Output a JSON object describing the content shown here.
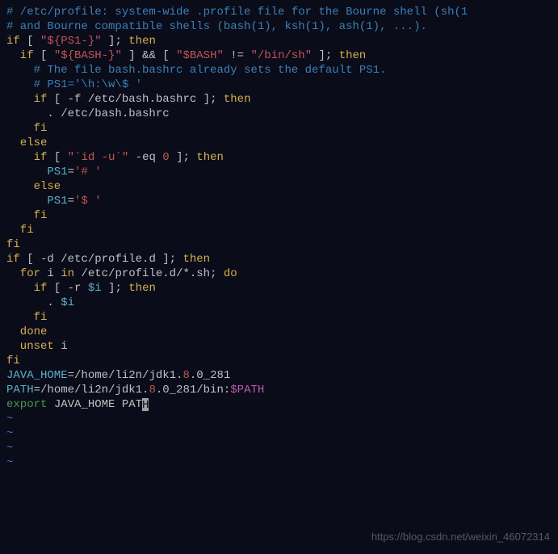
{
  "lines": {
    "l1_comment": "# /etc/profile: system-wide .profile file for the Bourne shell (sh(1",
    "l2_comment": "# and Bourne compatible shells (bash(1), ksh(1), ash(1), ...).",
    "l3": "",
    "l4_if": "if",
    "l4_mid": " [ ",
    "l4_str": "\"${PS1-}\"",
    "l4_end": " ]; ",
    "l4_then": "then",
    "l5_if": "  if",
    "l5_a": " [ ",
    "l5_s1": "\"${BASH-}\"",
    "l5_b": " ] && [ ",
    "l5_s2": "\"$BASH\"",
    "l5_c": " != ",
    "l5_s3": "\"/bin/sh\"",
    "l5_d": " ]; ",
    "l5_then": "then",
    "l6_comment": "    # The file bash.bashrc already sets the default PS1.",
    "l7_comment": "    # PS1='\\h:\\w\\$ '",
    "l8_if": "    if",
    "l8_a": " [ -f ",
    "l8_p": "/etc/bash.bashrc",
    "l8_b": " ]; ",
    "l8_then": "then",
    "l9_a": "      . ",
    "l9_p": "/etc/bash.bashrc",
    "l10_fi": "    fi",
    "l11_else": "  else",
    "l12_if": "    if",
    "l12_a": " [ ",
    "l12_s1": "\"`id -u`\"",
    "l12_b": " -eq ",
    "l12_n": "0",
    "l12_c": " ]; ",
    "l12_then": "then",
    "l13_v": "      PS1",
    "l13_eq": "=",
    "l13_s": "'# '",
    "l14_else": "    else",
    "l15_v": "      PS1",
    "l15_eq": "=",
    "l15_s": "'$ '",
    "l16_fi": "    fi",
    "l17_fi": "  fi",
    "l18_fi": "fi",
    "l19": "",
    "l20_if": "if",
    "l20_a": " [ -d ",
    "l20_p": "/etc/profile.d",
    "l20_b": " ]; ",
    "l20_then": "then",
    "l21_for": "  for",
    "l21_i": " i ",
    "l21_in": "in",
    "l21_p": " /etc/profile.d/*.sh",
    "l21_do": "; ",
    "l21_do2": "do",
    "l22_if": "    if",
    "l22_a": " [ -r ",
    "l22_v": "$i",
    "l22_b": " ]; ",
    "l22_then": "then",
    "l23_a": "      . ",
    "l23_v": "$i",
    "l24_fi": "    fi",
    "l25_done": "  done",
    "l26_unset": "  unset",
    "l26_i": " i",
    "l27_fi": "fi",
    "l28_v": "JAVA_HOME",
    "l28_eq": "=",
    "l28_p1": "/home/li2n/jdk1.",
    "l28_n": "8",
    "l28_p2": ".0_281",
    "l29_v": "PATH",
    "l29_eq": "=",
    "l29_p1": "/home/li2n/jdk1.",
    "l29_n": "8",
    "l29_p2": ".0_281/bin:",
    "l29_v2": "$PATH",
    "l30_exp": "export",
    "l30_vars": " JAVA_HOME PAT",
    "l30_cur": "H",
    "tilde": "~"
  },
  "watermark": "https://blog.csdn.net/weixin_46072314"
}
